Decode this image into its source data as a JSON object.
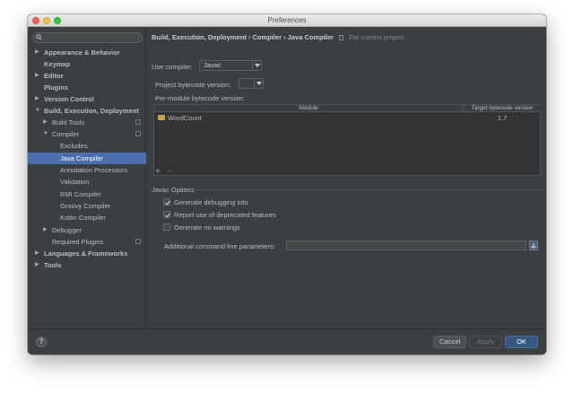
{
  "window": {
    "title": "Preferences"
  },
  "sidebar": {
    "search_placeholder": "",
    "items": [
      {
        "label": "Appearance & Behavior",
        "bold": true,
        "arrow": "right",
        "indent": 0
      },
      {
        "label": "Keymap",
        "bold": true,
        "arrow": "",
        "indent": 0
      },
      {
        "label": "Editor",
        "bold": true,
        "arrow": "right",
        "indent": 0
      },
      {
        "label": "Plugins",
        "bold": true,
        "arrow": "",
        "indent": 0
      },
      {
        "label": "Version Control",
        "bold": true,
        "arrow": "right",
        "indent": 0
      },
      {
        "label": "Build, Execution, Deployment",
        "bold": true,
        "arrow": "down",
        "indent": 0
      },
      {
        "label": "Build Tools",
        "bold": false,
        "arrow": "right",
        "indent": 1,
        "cfg": true
      },
      {
        "label": "Compiler",
        "bold": false,
        "arrow": "down",
        "indent": 1,
        "cfg": true
      },
      {
        "label": "Excludes",
        "bold": false,
        "arrow": "",
        "indent": 2
      },
      {
        "label": "Java Compiler",
        "bold": false,
        "arrow": "",
        "indent": 2,
        "selected": true
      },
      {
        "label": "Annotation Processors",
        "bold": false,
        "arrow": "",
        "indent": 2
      },
      {
        "label": "Validation",
        "bold": false,
        "arrow": "",
        "indent": 2
      },
      {
        "label": "RMI Compiler",
        "bold": false,
        "arrow": "",
        "indent": 2
      },
      {
        "label": "Groovy Compiler",
        "bold": false,
        "arrow": "",
        "indent": 2
      },
      {
        "label": "Kotlin Compiler",
        "bold": false,
        "arrow": "",
        "indent": 2
      },
      {
        "label": "Debugger",
        "bold": false,
        "arrow": "right",
        "indent": 1
      },
      {
        "label": "Required Plugins",
        "bold": false,
        "arrow": "",
        "indent": 1,
        "cfg": true
      },
      {
        "label": "Languages & Frameworks",
        "bold": true,
        "arrow": "right",
        "indent": 0
      },
      {
        "label": "Tools",
        "bold": true,
        "arrow": "right",
        "indent": 0
      }
    ]
  },
  "breadcrumb": {
    "text": "Build, Execution, Deployment › Compiler › Java Compiler",
    "note": "For current project"
  },
  "compiler": {
    "use_compiler_label": "Use compiler:",
    "use_compiler_value": "Javac",
    "bytecode_label": "Project bytecode version:",
    "bytecode_value": "",
    "per_module_label": "Per-module bytecode version:"
  },
  "module_table": {
    "col_module": "Module",
    "col_target": "Target bytecode version",
    "rows": [
      {
        "module": "WordCount",
        "target": "1.7"
      }
    ]
  },
  "toolbar": {
    "add": "+",
    "remove": "−"
  },
  "javac": {
    "section_label": "Javac Options",
    "debug_label": "Generate debugging info",
    "debug_checked": true,
    "deprecated_label": "Report use of deprecated features",
    "deprecated_checked": true,
    "nowarn_label": "Generate no warnings",
    "nowarn_checked": false,
    "params_label": "Additional command line parameters:",
    "params_value": ""
  },
  "footer": {
    "help": "?",
    "cancel": "Cancel",
    "apply": "Apply",
    "ok": "OK"
  },
  "colors": {
    "background": "#3c3f41",
    "selection": "#4b6eaf",
    "ok_button": "#365880"
  }
}
